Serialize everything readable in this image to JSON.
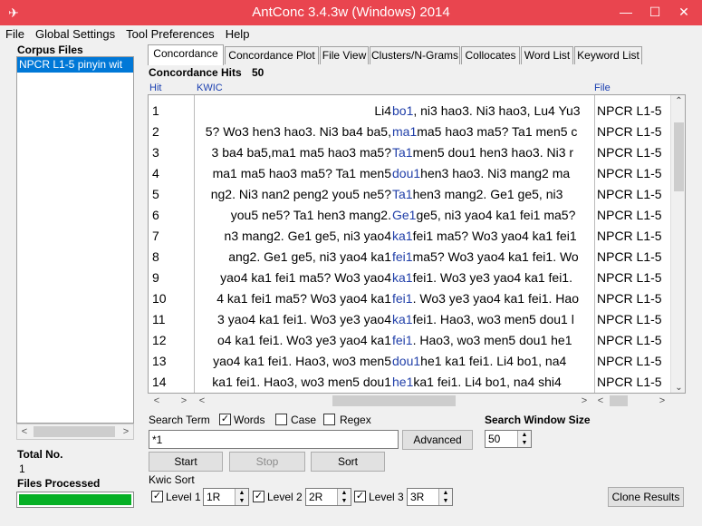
{
  "window": {
    "title": "AntConc 3.4.3w (Windows) 2014",
    "minimize": "—",
    "maximize": "☐",
    "close": "✕"
  },
  "menu": [
    "File",
    "Global Settings",
    "Tool Preferences",
    "Help"
  ],
  "left_panel": {
    "corpus_files_label": "Corpus Files",
    "files": [
      "NPCR L1-5 pinyin wit"
    ],
    "total_no_label": "Total No.",
    "total_no": "1",
    "files_processed_label": "Files Processed",
    "progress": 1.0
  },
  "tabs": [
    "Concordance",
    "Concordance Plot",
    "File View",
    "Clusters/N-Grams",
    "Collocates",
    "Word List",
    "Keyword List"
  ],
  "concordance": {
    "hits_label": "Concordance Hits",
    "hits_count": "50",
    "col_hit": "Hit",
    "col_kwic": "KWIC",
    "col_file": "File",
    "rows": [
      {
        "hit": "1",
        "left": "Li4",
        "key": "bo1",
        "right": ", ni3 hao3. Ni3 hao3, Lu4 Yu3",
        "file": "NPCR L1-5"
      },
      {
        "hit": "2",
        "left": "5? Wo3 hen3 hao3. Ni3 ba4 ba5,",
        "key": "ma1",
        "right": " ma5 hao3 ma5? Ta1 men5 c",
        "file": "NPCR L1-5"
      },
      {
        "hit": "3",
        "left": "3 ba4 ba5,ma1 ma5 hao3 ma5?",
        "key": "Ta1",
        "right": " men5 dou1 hen3 hao3. Ni3 r",
        "file": "NPCR L1-5"
      },
      {
        "hit": "4",
        "left": "ma1 ma5 hao3 ma5? Ta1 men5",
        "key": "dou1",
        "right": " hen3 hao3. Ni3 mang2 ma",
        "file": "NPCR L1-5"
      },
      {
        "hit": "5",
        "left": "ng2. Ni3 nan2 peng2 you5 ne5?",
        "key": "Ta1",
        "right": " hen3 mang2.   Ge1 ge5, ni3",
        "file": "NPCR L1-5"
      },
      {
        "hit": "6",
        "left": "you5 ne5? Ta1 hen3 mang2.",
        "key": "Ge1",
        "right": " ge5, ni3 yao4 ka1 fei1 ma5?",
        "file": "NPCR L1-5"
      },
      {
        "hit": "7",
        "left": "n3 mang2.   Ge1 ge5, ni3 yao4",
        "key": "ka1",
        "right": " fei1 ma5? Wo3 yao4 ka1 fei1",
        "file": "NPCR L1-5"
      },
      {
        "hit": "8",
        "left": "ang2.   Ge1 ge5, ni3 yao4 ka1",
        "key": "fei1",
        "right": " ma5? Wo3 yao4 ka1 fei1. Wo",
        "file": "NPCR L1-5"
      },
      {
        "hit": "9",
        "left": "yao4 ka1 fei1 ma5? Wo3 yao4",
        "key": "ka1",
        "right": " fei1. Wo3 ye3 yao4 ka1 fei1.",
        "file": "NPCR L1-5"
      },
      {
        "hit": "10",
        "left": "4 ka1 fei1 ma5? Wo3 yao4 ka1",
        "key": "fei1",
        "right": ". Wo3 ye3 yao4 ka1 fei1. Hao",
        "file": "NPCR L1-5"
      },
      {
        "hit": "11",
        "left": "3 yao4 ka1 fei1. Wo3 ye3 yao4",
        "key": "ka1",
        "right": " fei1. Hao3, wo3 men5 dou1 l",
        "file": "NPCR L1-5"
      },
      {
        "hit": "12",
        "left": "o4 ka1 fei1. Wo3 ye3 yao4 ka1",
        "key": "fei1",
        "right": ". Hao3, wo3 men5 dou1 he1",
        "file": "NPCR L1-5"
      },
      {
        "hit": "13",
        "left": "yao4 ka1 fei1. Hao3, wo3 men5",
        "key": "dou1",
        "right": " he1 ka1 fei1.   Li4 bo1, na4",
        "file": "NPCR L1-5"
      },
      {
        "hit": "14",
        "left": "ka1 fei1. Hao3, wo3 men5 dou1",
        "key": "he1",
        "right": " ka1 fei1.   Li4 bo1, na4 shi4",
        "file": "NPCR L1-5"
      }
    ]
  },
  "search": {
    "term_label": "Search Term",
    "words_label": "Words",
    "words_checked": true,
    "case_label": "Case",
    "case_checked": false,
    "regex_label": "Regex",
    "regex_checked": false,
    "value": "*1",
    "advanced_label": "Advanced",
    "window_size_label": "Search Window Size",
    "window_size": "50",
    "start_label": "Start",
    "stop_label": "Stop",
    "sort_label": "Sort"
  },
  "kwic_sort": {
    "label": "Kwic Sort",
    "levels": [
      {
        "label": "Level 1",
        "value": "1R",
        "checked": true
      },
      {
        "label": "Level 2",
        "value": "2R",
        "checked": true
      },
      {
        "label": "Level 3",
        "value": "3R",
        "checked": true
      }
    ],
    "clone_label": "Clone Results"
  }
}
